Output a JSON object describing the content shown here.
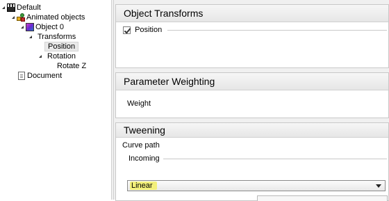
{
  "tree": {
    "items": [
      {
        "label": "Default",
        "icon": "clapperboard-icon",
        "expanded": true
      },
      {
        "label": "Animated objects",
        "icon": "shapes-icon",
        "expanded": true
      },
      {
        "label": "Object 0",
        "icon": "cube-icon",
        "expanded": true
      },
      {
        "label": "Transforms",
        "expanded": true
      },
      {
        "label": "Position",
        "selected": true
      },
      {
        "label": "Rotation",
        "expanded": true
      },
      {
        "label": "Rotate Z"
      },
      {
        "label": "Document",
        "icon": "document-icon"
      }
    ]
  },
  "object_transforms": {
    "title": "Object Transforms",
    "position_label": "Position",
    "position_checked": true
  },
  "parameter_weighting": {
    "title": "Parameter Weighting",
    "weight_label": "Weight"
  },
  "tweening": {
    "title": "Tweening",
    "curve_path_label": "Curve path",
    "incoming_label": "Incoming",
    "incoming_value": "Linear",
    "highlight_color": "#f3f07a"
  }
}
